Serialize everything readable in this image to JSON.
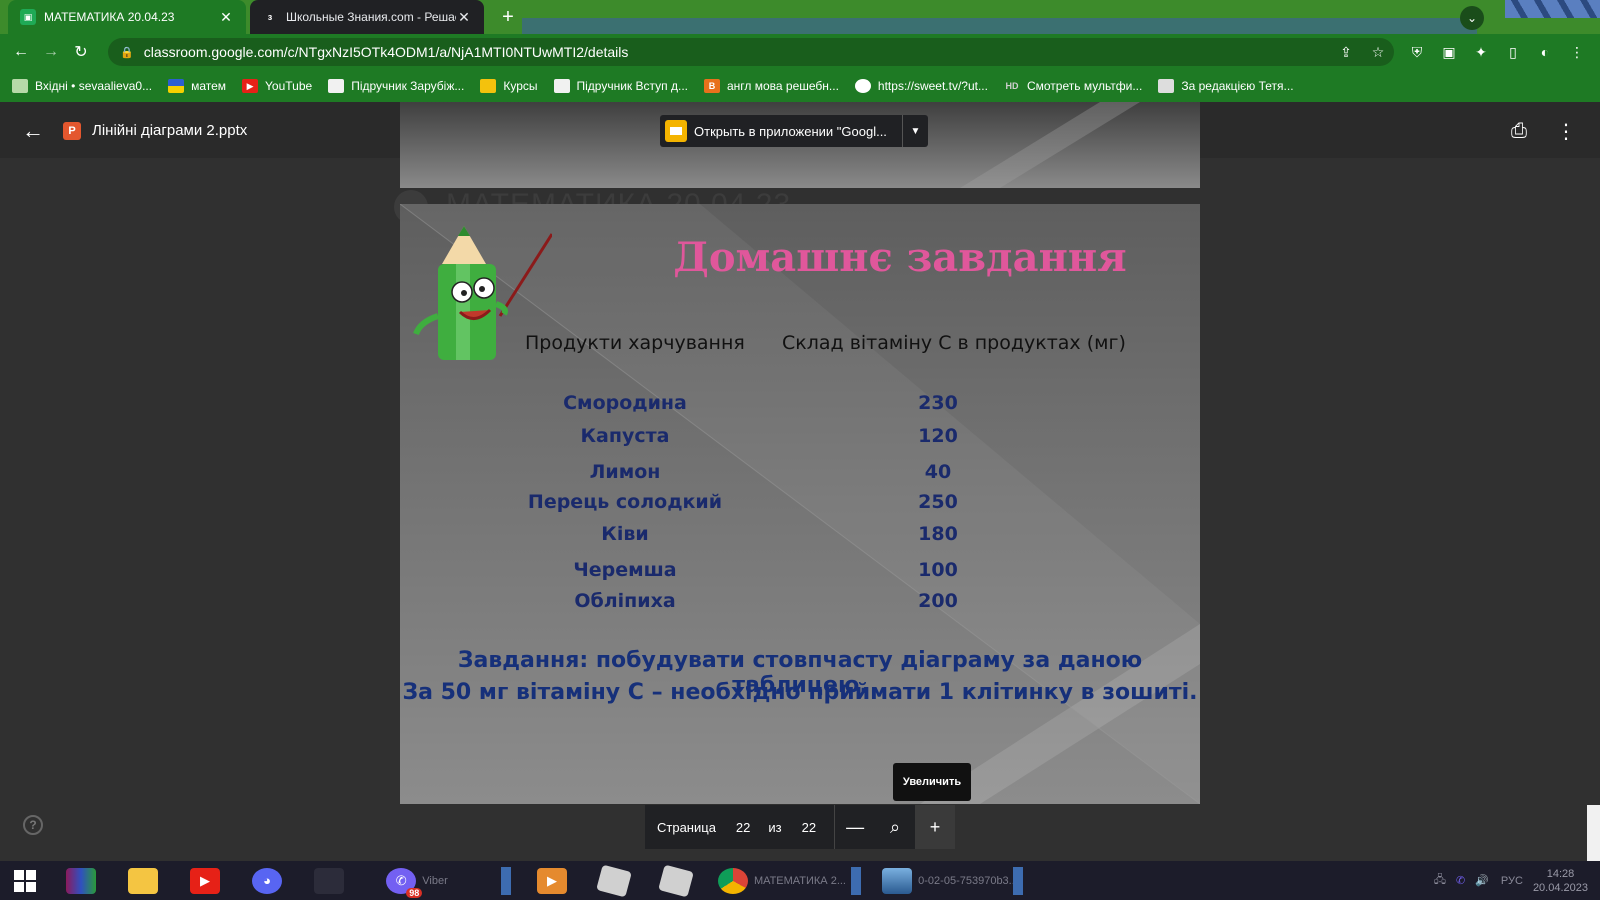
{
  "browser": {
    "tabs": [
      {
        "title": "МАТЕМАТИКА 20.04.23",
        "active": true,
        "icon": "classroom-icon"
      },
      {
        "title": "Школьные Знания.com - Решае",
        "active": false,
        "icon": "znanija-icon"
      }
    ],
    "url": "classroom.google.com/c/NTgxNzI5OTk4ODM1/a/NjA1MTI0NTUwMTI2/details",
    "bookmarks": [
      {
        "label": "Вхідні • sevaalieva0...",
        "icon": "gmail-icon"
      },
      {
        "label": "матем",
        "icon": "flag-icon"
      },
      {
        "label": "YouTube",
        "icon": "youtube-icon"
      },
      {
        "label": "Підручник Зарубіж...",
        "icon": "folder-icon"
      },
      {
        "label": "Курсы",
        "icon": "classroom-icon"
      },
      {
        "label": "Підручник Вступ д...",
        "icon": "folder-icon"
      },
      {
        "label": "англ мова решебн...",
        "icon": "book-icon"
      },
      {
        "label": "https://sweet.tv/?ut...",
        "icon": "sweettv-icon"
      },
      {
        "label": "Смотреть мультфи...",
        "icon": "hd-icon"
      },
      {
        "label": "За редакцією Тетя...",
        "icon": "person-icon"
      }
    ]
  },
  "viewer": {
    "file_name": "Лінійні діаграми 2.pptx",
    "open_in_app": "Открыть в приложении \"Googl...",
    "ghost_title": "МАТЕМАТИКА 20.04.23",
    "zoom_tooltip": "Увеличить",
    "pager": {
      "label": "Страница",
      "current": "22",
      "of": "из",
      "total": "22"
    }
  },
  "slide": {
    "title": "Домашнє завдання",
    "col_food": "Продукти харчування",
    "col_vitamin": "Склад вітаміну С в продуктах (мг)",
    "rows": [
      {
        "food": "Смородина",
        "value": "230"
      },
      {
        "food": "Капуста",
        "value": "120"
      },
      {
        "food": "Лимон",
        "value": "40"
      },
      {
        "food": "Перець солодкий",
        "value": "250"
      },
      {
        "food": "Ківи",
        "value": "180"
      },
      {
        "food": "Черемша",
        "value": "100"
      },
      {
        "food": "Обліпиха",
        "value": "200"
      }
    ],
    "task_line1": "Завдання: побудувати стовпчасту діаграму за даною таблицею.",
    "task_line2": "За 50 мг вітаміну С – необхідно приймати 1 клітинку в зошиті."
  },
  "taskbar": {
    "viber_label": "Viber",
    "viber_badge": "98",
    "chrome_label": "МАТЕМАТИКА 2...",
    "photo_label": "0-02-05-753970b3...",
    "lang": "РУС",
    "time": "14:28",
    "date": "20.04.2023"
  },
  "colors": {
    "chrome_green": "#1e7a24",
    "slide_title": "#e0579b",
    "slide_text": "#1a2a6c"
  }
}
